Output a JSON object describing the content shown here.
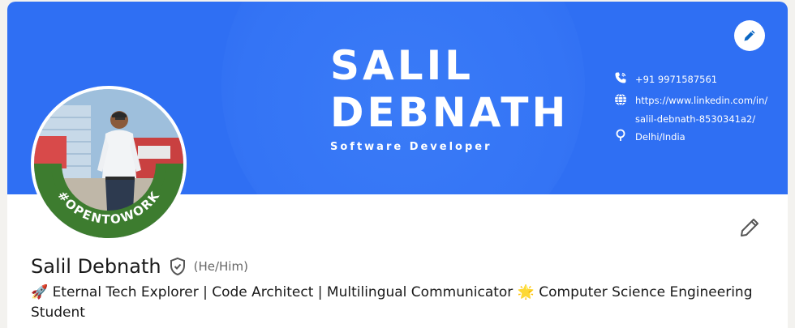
{
  "banner": {
    "name_line1": "SALIL",
    "name_line2": "DEBNATH",
    "role": "Software Developer",
    "contacts": {
      "phone": "+91 9971587561",
      "linkedin_line1": "https://www.linkedin.com/in/",
      "linkedin_line2": "salil-debnath-8530341a2/",
      "location": "Delhi/India"
    }
  },
  "avatar": {
    "open_to_work_text": "#OPENTOWORK"
  },
  "profile": {
    "name": "Salil Debnath",
    "pronouns": "(He/Him)",
    "headline": "🚀 Eternal Tech Explorer | Code Architect | Multilingual Communicator 🌟 Computer Science Engineering Student"
  },
  "icons": {
    "edit_banner": "pencil-icon",
    "edit_profile": "pencil-icon",
    "verified": "shield-check-icon",
    "phone": "phone-icon",
    "globe": "globe-icon",
    "location": "location-pin-icon"
  },
  "colors": {
    "banner_blue": "#2f6ff3",
    "open_to_work_green": "#3d7c2f",
    "edit_icon_blue": "#0a66c2"
  }
}
